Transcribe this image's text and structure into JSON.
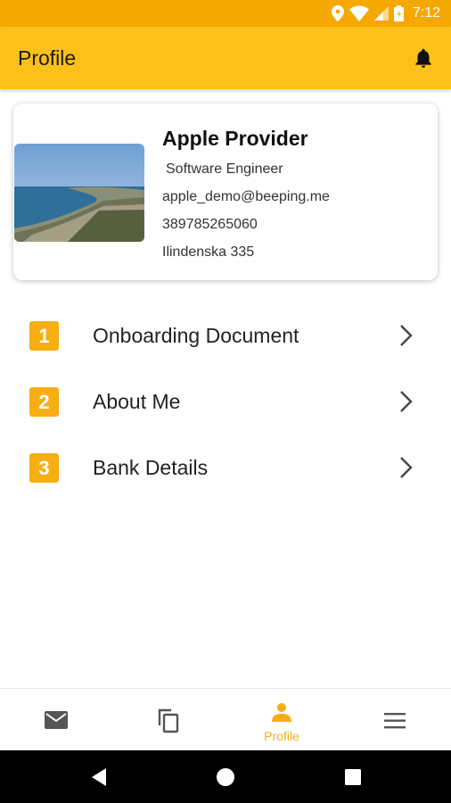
{
  "status_bar": {
    "time": "7:12"
  },
  "app_bar": {
    "title": "Profile",
    "notification_icon": "bell-icon"
  },
  "profile": {
    "name": "Apple Provider",
    "job_title": "Software Engineer",
    "email": "apple_demo@beeping.me",
    "phone": "389785265060",
    "address": "Ilindenska 335"
  },
  "menu": [
    {
      "number": "1",
      "label": "Onboarding Document"
    },
    {
      "number": "2",
      "label": "About Me"
    },
    {
      "number": "3",
      "label": "Bank Details"
    }
  ],
  "bottom_nav": {
    "items": [
      {
        "icon": "mail-icon",
        "label": ""
      },
      {
        "icon": "copy-icon",
        "label": ""
      },
      {
        "icon": "person-icon",
        "label": "Profile",
        "active": true
      },
      {
        "icon": "menu-icon",
        "label": ""
      }
    ]
  },
  "colors": {
    "accent": "#fbc11a",
    "status_bar": "#f5a800",
    "badge": "#f7ae12"
  }
}
